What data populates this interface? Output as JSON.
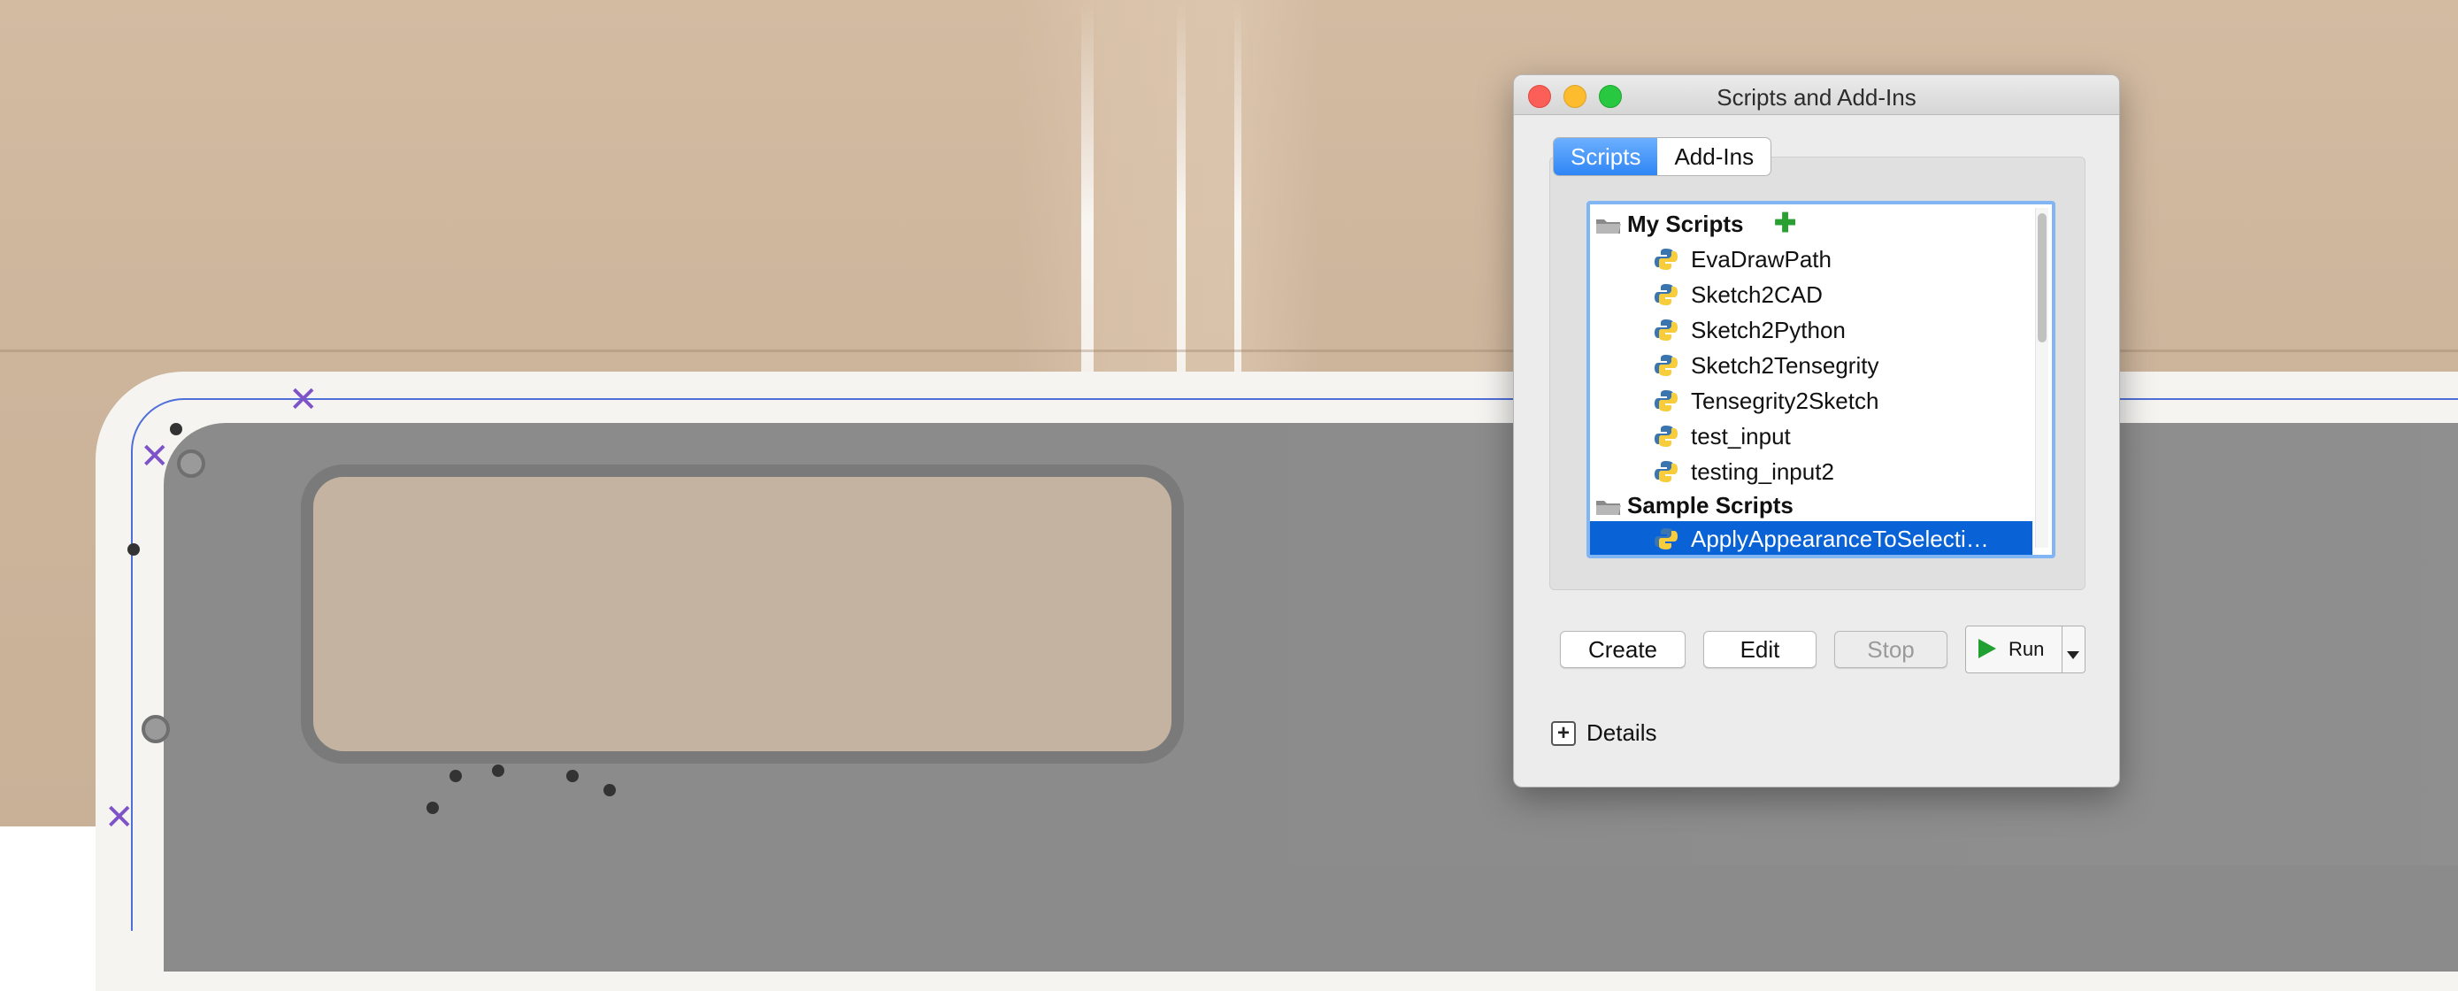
{
  "window": {
    "title": "Scripts and Add-Ins"
  },
  "tabs": [
    {
      "label": "Scripts",
      "active": true
    },
    {
      "label": "Add-Ins",
      "active": false
    }
  ],
  "script_tree": {
    "my_scripts": {
      "label": "My Scripts",
      "items": [
        "EvaDrawPath",
        "Sketch2CAD",
        "Sketch2Python",
        "Sketch2Tensegrity",
        "Tensegrity2Sketch",
        "test_input",
        "testing_input2"
      ]
    },
    "sample_scripts": {
      "label": "Sample Scripts",
      "items": [
        "ApplyAppearanceToSelecti…"
      ],
      "selected_index": 0
    }
  },
  "buttons": {
    "create": "Create",
    "edit": "Edit",
    "stop": "Stop",
    "run": "Run"
  },
  "details": {
    "toggle": "+",
    "label": "Details"
  },
  "icons": {
    "folder": "folder-icon",
    "python": "python-icon",
    "add": "plus-icon",
    "play": "play-icon",
    "dropdown": "chevron-down-icon",
    "expand": "plus-box-icon"
  },
  "colors": {
    "selection": "#0a63d6",
    "tab_active": "#2f86f5",
    "add_green": "#2aa033",
    "run_green": "#1fa030"
  }
}
